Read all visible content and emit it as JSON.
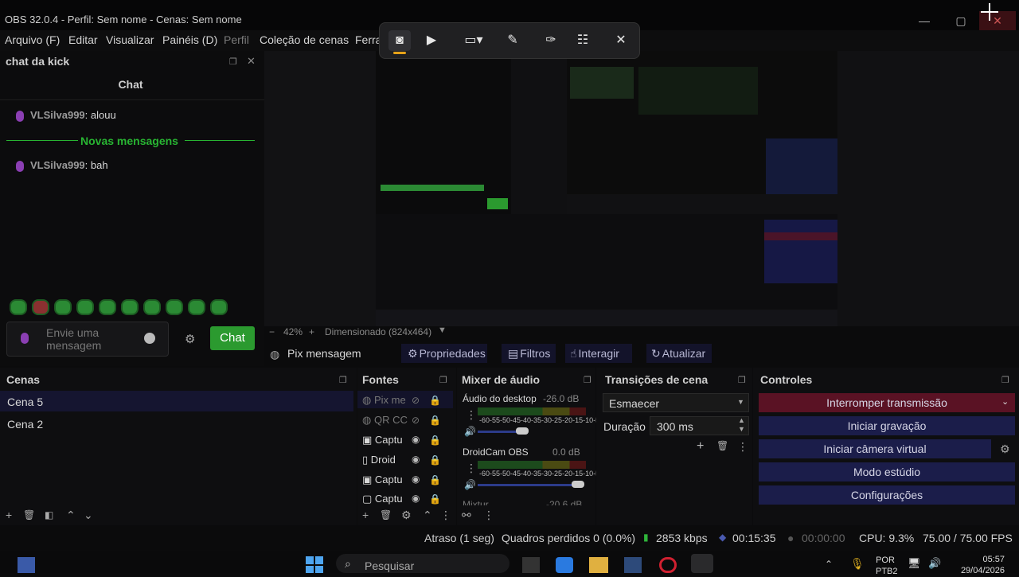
{
  "window": {
    "title": "OBS 32.0.4 - Perfil: Sem nome - Cenas: Sem nome",
    "minimize": "—",
    "maximize": "▢",
    "close": "✕"
  },
  "menu": [
    "Arquivo (F)",
    "Editar",
    "Visualizar",
    "Painéis (D)",
    "Perfil",
    "Coleção de cenas",
    "Ferra"
  ],
  "chat_dock": {
    "title": "chat da kick",
    "chat_header": "Chat",
    "messages": [
      {
        "user": "VLSilva999",
        "text": ": alouu"
      },
      {
        "user": "VLSilva999",
        "text": ": bah"
      }
    ],
    "new_messages": "Novas mensagens",
    "input_placeholder": "Envie uma mensagem",
    "send_button": "Chat"
  },
  "preview": {
    "zoom": "42%",
    "scale_info": "Dimensionado (824x464)"
  },
  "toolbar": {
    "pix": "Pix mensagem",
    "properties": "Propriedades",
    "filters": "Filtros",
    "interact": "Interagir",
    "refresh": "Atualizar"
  },
  "scenes": {
    "title": "Cenas",
    "items": [
      "Cena 5",
      "Cena 2"
    ]
  },
  "sources": {
    "title": "Fontes",
    "items": [
      "Pix me",
      "QR CC",
      "Captu",
      "Droid",
      "Captu",
      "Captu"
    ]
  },
  "mixer": {
    "title": "Mixer de áudio",
    "channels": [
      {
        "name": "Áudio do desktop",
        "level": "-26.0 dB"
      },
      {
        "name": "DroidCam OBS",
        "level": "0.0 dB"
      }
    ],
    "scale": "-60-55-50-45-40-35-30-25-20-15-10-5-0",
    "partial": "Mixtur",
    "partial_level": "-20.6 dB"
  },
  "transitions": {
    "title": "Transições de cena",
    "selected": "Esmaecer",
    "duration_label": "Duração",
    "duration_value": "300 ms"
  },
  "controls": {
    "title": "Controles",
    "buttons": [
      "Interromper transmissão",
      "Iniciar gravação",
      "Iniciar câmera virtual",
      "Modo estúdio",
      "Configurações"
    ]
  },
  "status": {
    "delay": "Atraso (1 seg)",
    "dropped": "Quadros perdidos 0 (0.0%)",
    "bitrate": "2853 kbps",
    "stream_time": "00:15:35",
    "rec_time": "00:00:00",
    "cpu": "CPU: 9.3%",
    "fps": "75.00 / 75.00 FPS"
  },
  "taskbar": {
    "search": "Pesquisar",
    "lang": "POR",
    "lang2": "PTB2",
    "time": "05:57",
    "date": "29/04/2026"
  },
  "colors": {
    "accent_green": "#28b532",
    "controls_blue": "#1b1d4a",
    "stop_red": "#5a1224"
  }
}
